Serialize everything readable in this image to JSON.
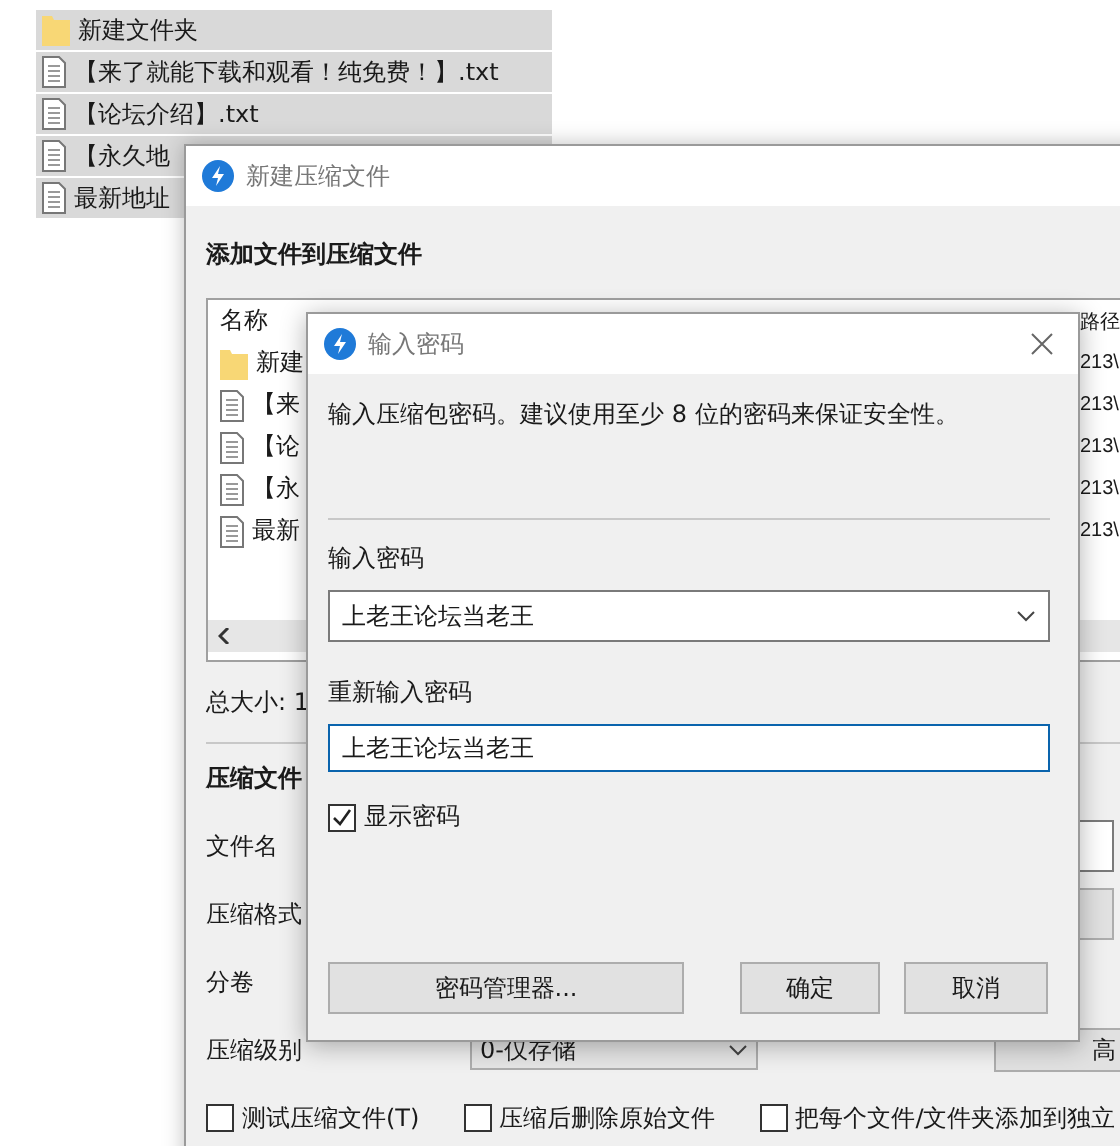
{
  "explorer": {
    "items": [
      {
        "kind": "folder",
        "name": "新建文件夹"
      },
      {
        "kind": "file",
        "name": "【来了就能下载和观看！纯免费！】.txt"
      },
      {
        "kind": "file",
        "name": "【论坛介绍】.txt"
      },
      {
        "kind": "file",
        "name": "【永久地"
      },
      {
        "kind": "file",
        "name": "最新地址"
      }
    ]
  },
  "main_window": {
    "title": "新建压缩文件",
    "section_title": "添加文件到压缩文件",
    "file_list": {
      "columns": [
        "名称",
        "路径"
      ],
      "rows": [
        {
          "kind": "folder",
          "name": "新建",
          "path": "213\\"
        },
        {
          "kind": "file",
          "name": "【来",
          "path": "213\\"
        },
        {
          "kind": "file",
          "name": "【论",
          "path": "213\\"
        },
        {
          "kind": "file",
          "name": "【永",
          "path": "213\\"
        },
        {
          "kind": "file",
          "name": "最新",
          "path": "213\\"
        }
      ]
    },
    "total_size": "总大小: 1",
    "settings_title": "压缩文件",
    "settings": [
      {
        "label": "文件名",
        "kind": "field"
      },
      {
        "label": "压缩格式",
        "kind": "button"
      },
      {
        "label": "分卷",
        "kind": "none"
      },
      {
        "label": "压缩级别",
        "kind": "level",
        "value": "0-仅存储",
        "button": "高"
      }
    ],
    "options": [
      {
        "label": "测试压缩文件(T)",
        "checked": false
      },
      {
        "label": "压缩后删除原始文件",
        "checked": false
      },
      {
        "label": "把每个文件/文件夹添加到独立",
        "checked": false
      }
    ]
  },
  "dialog": {
    "title": "输入密码",
    "message": "输入压缩包密码。建议使用至少 8 位的密码来保证安全性。",
    "password_label": "输入密码",
    "password": "上老王论坛当老王",
    "confirm_label": "重新输入密码",
    "confirm": "上老王论坛当老王",
    "show_password": {
      "label": "显示密码",
      "checked": true
    },
    "buttons": [
      "密码管理器...",
      "确定",
      "取消"
    ]
  }
}
